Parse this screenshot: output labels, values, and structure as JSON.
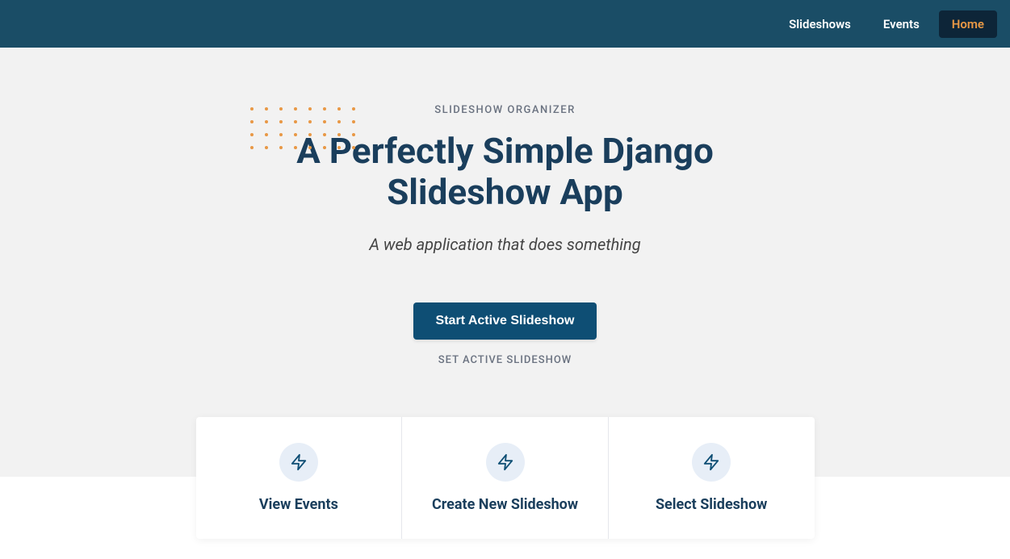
{
  "nav": {
    "items": [
      {
        "label": "Slideshows",
        "active": false
      },
      {
        "label": "Events",
        "active": false
      },
      {
        "label": "Home",
        "active": true
      }
    ]
  },
  "hero": {
    "eyebrow": "SLIDESHOW ORGANIZER",
    "headline_line1": "A Perfectly Simple Django",
    "headline_line2": "Slideshow App",
    "tagline": "A web application that does something",
    "primary_button": "Start Active Slideshow",
    "secondary_link": "SET ACTIVE SLIDESHOW"
  },
  "cards": [
    {
      "title": "View Events"
    },
    {
      "title": "Create New Slideshow"
    },
    {
      "title": "Select Slideshow"
    }
  ]
}
